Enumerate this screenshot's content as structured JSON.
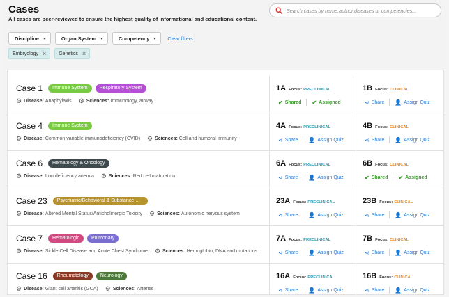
{
  "header": {
    "title": "Cases",
    "subtitle": "All cases are peer-reviewed to ensure the highest quality of informational and educational content."
  },
  "search": {
    "placeholder": "Search cases by name,author,diseases or competencies..."
  },
  "filters": {
    "discipline": "Discipline",
    "organ_system": "Organ System",
    "competency": "Competency",
    "clear": "Clear filters"
  },
  "chips": [
    {
      "label": "Embryology",
      "close": "×"
    },
    {
      "label": "Genetics",
      "close": "×"
    }
  ],
  "labels": {
    "disease": "Disease:",
    "sciences": "Sciences:",
    "focus": "Focus:",
    "share": "Share",
    "assign": "Assign Quiz",
    "shared": "Shared",
    "assigned": "Assigned"
  },
  "colors": {
    "preclinical": "#2a9fb8",
    "clinical": "#f08a1d",
    "link": "#2b7bd2",
    "success": "#3a9a2c"
  },
  "cases": [
    {
      "name": "Case 1",
      "tags": [
        {
          "label": "Immune System",
          "color": "#7ac943"
        },
        {
          "label": "Respiratory System",
          "color": "#b44fd6"
        }
      ],
      "disease": "Anaphylaxis",
      "sciences": "Immunology, airway",
      "a": {
        "id": "1A",
        "focus": "PRECLINICAL",
        "state": "done"
      },
      "b": {
        "id": "1B",
        "focus": "CLINICAL",
        "state": "open"
      }
    },
    {
      "name": "Case 4",
      "tags": [
        {
          "label": "Immune System",
          "color": "#7ac943"
        }
      ],
      "disease": "Common variable immunodeficiency (CVID)",
      "sciences": "Cell and humoral immunity",
      "a": {
        "id": "4A",
        "focus": "PRECLINICAL",
        "state": "open"
      },
      "b": {
        "id": "4B",
        "focus": "CLINICAL",
        "state": "open"
      }
    },
    {
      "name": "Case 6",
      "tags": [
        {
          "label": "Hematology & Oncology",
          "color": "#3d4a4d"
        }
      ],
      "disease": "Iron deficiency anemia",
      "sciences": "Red cell maturation",
      "a": {
        "id": "6A",
        "focus": "PRECLINICAL",
        "state": "open"
      },
      "b": {
        "id": "6B",
        "focus": "CLINICAL",
        "state": "done"
      }
    },
    {
      "name": "Case 23",
      "tags": [
        {
          "label": "Psychiatric/Behavioral & Substance Use",
          "color": "#b8922c"
        }
      ],
      "disease": "Altered Mental Status/Anticholinergic Toxicity",
      "sciences": "Autonomic nervous system",
      "a": {
        "id": "23A",
        "focus": "PRECLINICAL",
        "state": "open"
      },
      "b": {
        "id": "23B",
        "focus": "CLINICAL",
        "state": "open"
      }
    },
    {
      "name": "Case 7",
      "tags": [
        {
          "label": "Hematologic",
          "color": "#d04a82"
        },
        {
          "label": "Pulmonary",
          "color": "#7a6fd0"
        }
      ],
      "disease": "Sickle Cell Disease and Acute Chest Syndrome",
      "sciences": "Hemoglobin, DNA and mutations",
      "a": {
        "id": "7A",
        "focus": "PRECLINICAL",
        "state": "open"
      },
      "b": {
        "id": "7B",
        "focus": "CLINICAL",
        "state": "open"
      }
    },
    {
      "name": "Case 16",
      "tags": [
        {
          "label": "Rheumatology",
          "color": "#8a3a24"
        },
        {
          "label": "Neurology",
          "color": "#4d7a3a"
        }
      ],
      "disease": "Giant cell arteritis (GCA)",
      "sciences": "Arteritis",
      "a": {
        "id": "16A",
        "focus": "PRECLINICAL",
        "state": "open"
      },
      "b": {
        "id": "16B",
        "focus": "CLINICAL",
        "state": "open"
      }
    }
  ]
}
